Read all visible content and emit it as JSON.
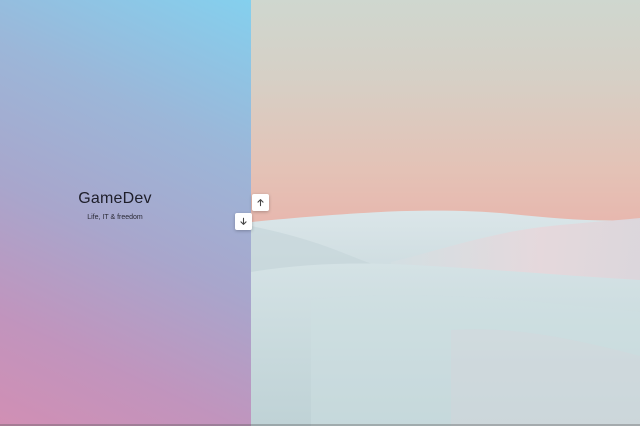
{
  "brand": {
    "title": "GameDev",
    "subtitle": "Life, IT & freedom"
  },
  "navigation": {
    "up_icon": "arrow-up-icon",
    "down_icon": "arrow-down-icon"
  },
  "colors": {
    "left_gradient_top": "#84d0ee",
    "left_gradient_bottom": "#d18fb4",
    "sky_top": "#cfd7cf",
    "sky_horizon": "#eaafa8",
    "dunes": "#d9e3e6"
  }
}
